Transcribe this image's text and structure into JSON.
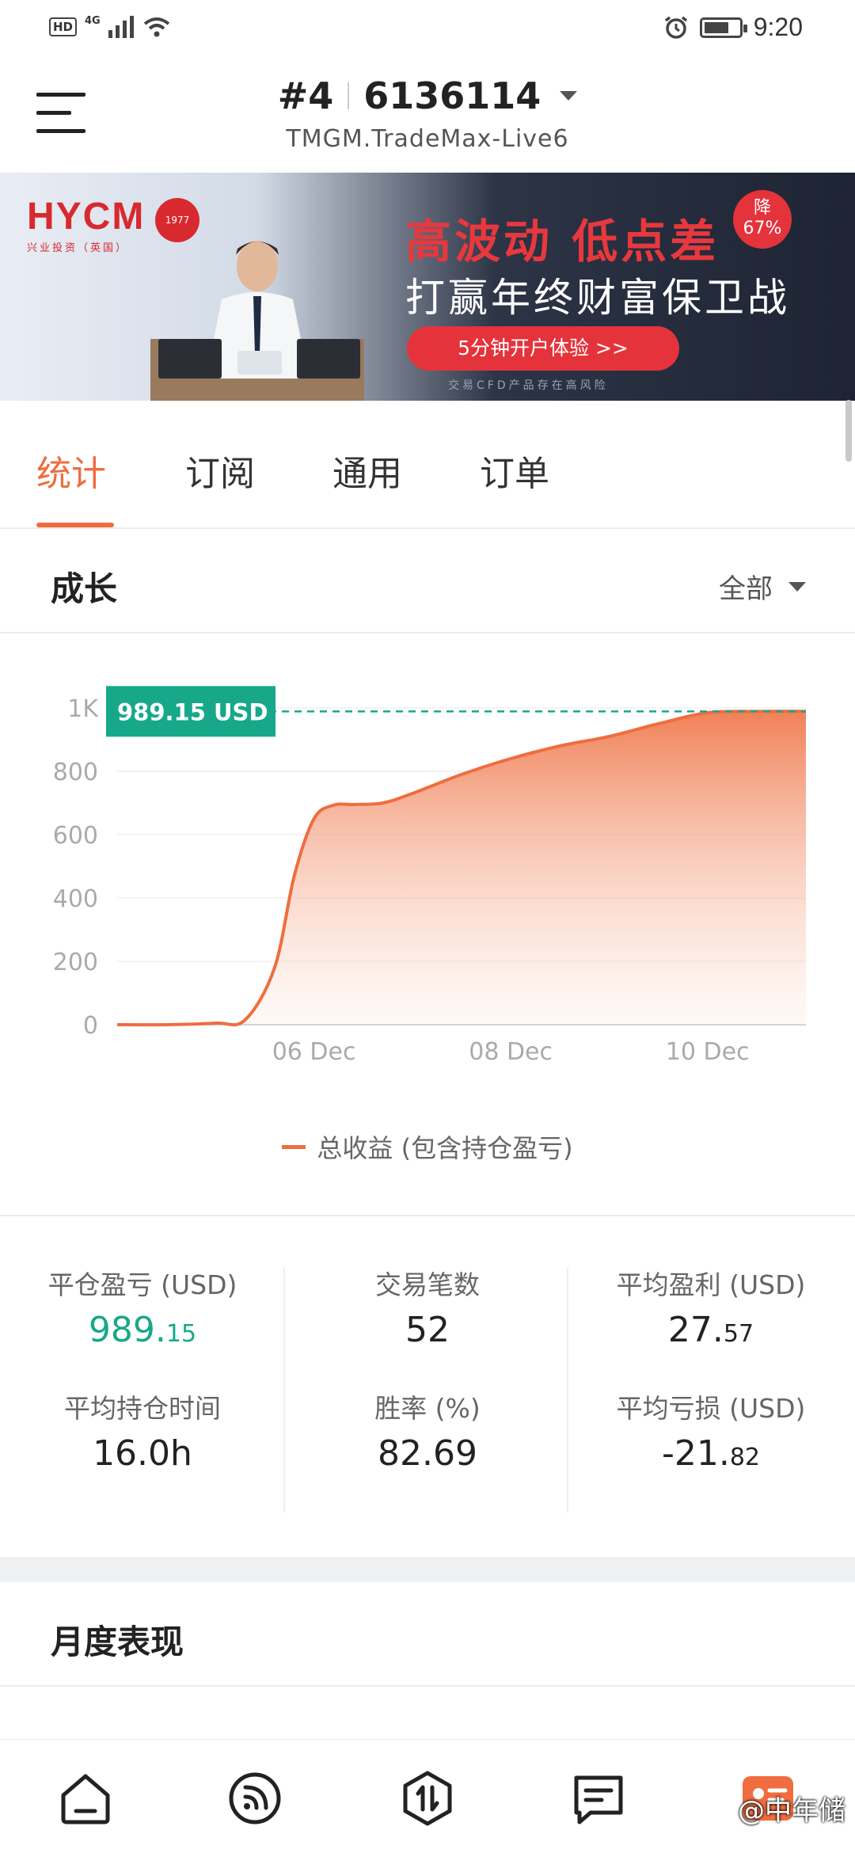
{
  "status_bar": {
    "hd": "HD",
    "network": "4G",
    "time": "9:20"
  },
  "header": {
    "account_index": "#4",
    "account_number": "6136114",
    "server": "TMGM.TradeMax-Live6"
  },
  "banner": {
    "logo": "HYCM",
    "logo_sub": "兴业投资（英国）",
    "seal": "1977",
    "headline": "高波动 低点差",
    "subline": "打赢年终财富保卫战",
    "cta": "5分钟开户体验 >>",
    "badge_top": "降",
    "badge_bottom": "67%",
    "note": "交易CFD产品存在高风险"
  },
  "tabs": [
    {
      "label": "统计",
      "active": true
    },
    {
      "label": "订阅",
      "active": false
    },
    {
      "label": "通用",
      "active": false
    },
    {
      "label": "订单",
      "active": false
    }
  ],
  "growth": {
    "title": "成长",
    "filter": "全部"
  },
  "chart_data": {
    "type": "area",
    "y_ticks": [
      "0",
      "200",
      "400",
      "600",
      "800",
      "1K"
    ],
    "x_ticks": [
      "06 Dec",
      "08 Dec",
      "10 Dec"
    ],
    "ylim": [
      0,
      1000
    ],
    "current_label": "989.15 USD",
    "current_value": 989.15,
    "series": [
      {
        "name": "总收益 (包含持仓盈亏)",
        "color": "#ef6d3f",
        "x": [
          4.0,
          4.5,
          5.0,
          5.3,
          5.6,
          5.8,
          6.0,
          6.2,
          6.4,
          6.7,
          7.0,
          7.5,
          8.0,
          8.5,
          9.0,
          9.5,
          10.0,
          10.5,
          11.0
        ],
        "values": [
          0,
          0,
          5,
          15,
          180,
          470,
          650,
          693,
          695,
          700,
          730,
          790,
          840,
          880,
          910,
          950,
          985,
          989,
          989.15
        ]
      }
    ],
    "x_range": [
      4.0,
      11.0
    ],
    "grid": true,
    "legend": "bottom-center"
  },
  "stats": [
    {
      "label": "平仓盈亏 (USD)",
      "int": "989.",
      "dec": "15",
      "color": "green"
    },
    {
      "label": "交易笔数",
      "int": "52",
      "dec": "",
      "color": "normal"
    },
    {
      "label": "平均盈利 (USD)",
      "int": "27.",
      "dec": "57",
      "color": "normal"
    },
    {
      "label": "平均持仓时间",
      "int": "16.0h",
      "dec": "",
      "color": "normal"
    },
    {
      "label": "胜率 (%)",
      "int": "82.69",
      "dec": "",
      "color": "normal"
    },
    {
      "label": "平均亏损 (USD)",
      "int": "-21.",
      "dec": "82",
      "color": "normal"
    }
  ],
  "monthly": {
    "title": "月度表现"
  },
  "watermark": "@中年储"
}
